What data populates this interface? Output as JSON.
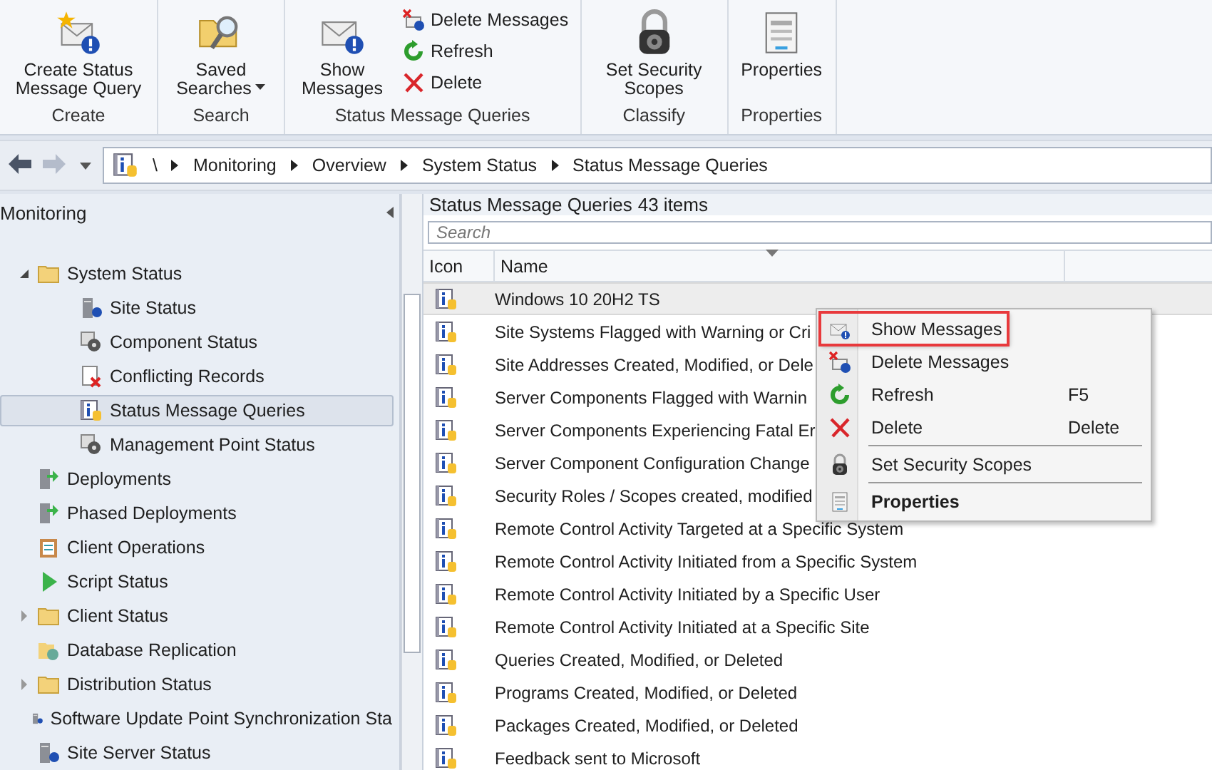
{
  "ribbon": {
    "groups": [
      {
        "label": "Create",
        "buttons": [
          {
            "kind": "large",
            "label": "Create Status Message Query",
            "dropdown": false
          }
        ]
      },
      {
        "label": "Search",
        "buttons": [
          {
            "kind": "large",
            "label": "Saved Searches",
            "dropdown": true
          }
        ]
      },
      {
        "label": "Status Message Queries",
        "buttons": [
          {
            "kind": "large",
            "label": "Show Messages",
            "dropdown": false
          },
          {
            "kind": "small",
            "label": "Delete Messages"
          },
          {
            "kind": "small",
            "label": "Refresh"
          },
          {
            "kind": "small",
            "label": "Delete"
          }
        ]
      },
      {
        "label": "Classify",
        "buttons": [
          {
            "kind": "large",
            "label": "Set Security Scopes",
            "dropdown": false
          }
        ]
      },
      {
        "label": "Properties",
        "buttons": [
          {
            "kind": "large",
            "label": "Properties",
            "dropdown": false
          }
        ]
      }
    ]
  },
  "navigation": {
    "back_enabled": true,
    "forward_enabled": false,
    "path": [
      "\\",
      "Monitoring",
      "Overview",
      "System Status",
      "Status Message Queries"
    ]
  },
  "tree": {
    "title": "Monitoring",
    "items": [
      {
        "label": "System Status",
        "expanded": true,
        "selected": false,
        "children": [
          {
            "label": "Site Status",
            "selected": false
          },
          {
            "label": "Component Status",
            "selected": false
          },
          {
            "label": "Conflicting Records",
            "selected": false
          },
          {
            "label": "Status Message Queries",
            "selected": true
          },
          {
            "label": "Management Point Status",
            "selected": false
          }
        ]
      },
      {
        "label": "Deployments",
        "selected": false
      },
      {
        "label": "Phased Deployments",
        "selected": false
      },
      {
        "label": "Client Operations",
        "selected": false
      },
      {
        "label": "Script Status",
        "selected": false
      },
      {
        "label": "Client Status",
        "expanded": false,
        "selected": false
      },
      {
        "label": "Database Replication",
        "selected": false
      },
      {
        "label": "Distribution Status",
        "expanded": false,
        "selected": false
      },
      {
        "label": "Software Update Point Synchronization Sta",
        "selected": false
      },
      {
        "label": "Site Server Status",
        "selected": false
      }
    ]
  },
  "list": {
    "title": "Status Message Queries",
    "count": "43 items",
    "search": {
      "placeholder": "Search"
    },
    "columns": [
      "Icon",
      "Name"
    ],
    "rows": [
      {
        "name": "Windows 10 20H2 TS",
        "selected": true
      },
      {
        "name": "Site Systems Flagged with Warning or Cri",
        "selected": false
      },
      {
        "name": "Site Addresses Created, Modified, or Dele",
        "selected": false
      },
      {
        "name": "Server Components Flagged with Warnin",
        "selected": false
      },
      {
        "name": "Server Components Experiencing Fatal Er",
        "selected": false
      },
      {
        "name": "Server Component Configuration Change",
        "selected": false
      },
      {
        "name": "Security Roles / Scopes created, modified",
        "selected": false
      },
      {
        "name": "Remote Control Activity Targeted at a Specific System",
        "selected": false
      },
      {
        "name": "Remote Control Activity Initiated from a Specific System",
        "selected": false
      },
      {
        "name": "Remote Control Activity Initiated by a Specific User",
        "selected": false
      },
      {
        "name": "Remote Control Activity Initiated at a Specific Site",
        "selected": false
      },
      {
        "name": "Queries Created, Modified, or Deleted",
        "selected": false
      },
      {
        "name": "Programs Created, Modified, or Deleted",
        "selected": false
      },
      {
        "name": "Packages Created, Modified, or Deleted",
        "selected": false
      },
      {
        "name": "Feedback sent to Microsoft",
        "selected": false
      }
    ]
  },
  "context_menu": {
    "items": [
      {
        "kind": "item",
        "label": "Show Messages",
        "highlighted": true,
        "bold": false
      },
      {
        "kind": "item",
        "label": "Delete Messages",
        "highlighted": false,
        "bold": false
      },
      {
        "kind": "item",
        "label": "Refresh",
        "shortcut": "F5",
        "highlighted": false,
        "bold": false
      },
      {
        "kind": "item",
        "label": "Delete",
        "shortcut": "Delete",
        "highlighted": false,
        "bold": false
      },
      {
        "kind": "separator"
      },
      {
        "kind": "item",
        "label": "Set Security Scopes",
        "highlighted": false,
        "bold": false
      },
      {
        "kind": "separator"
      },
      {
        "kind": "item",
        "label": "Properties",
        "highlighted": false,
        "bold": true
      }
    ]
  }
}
